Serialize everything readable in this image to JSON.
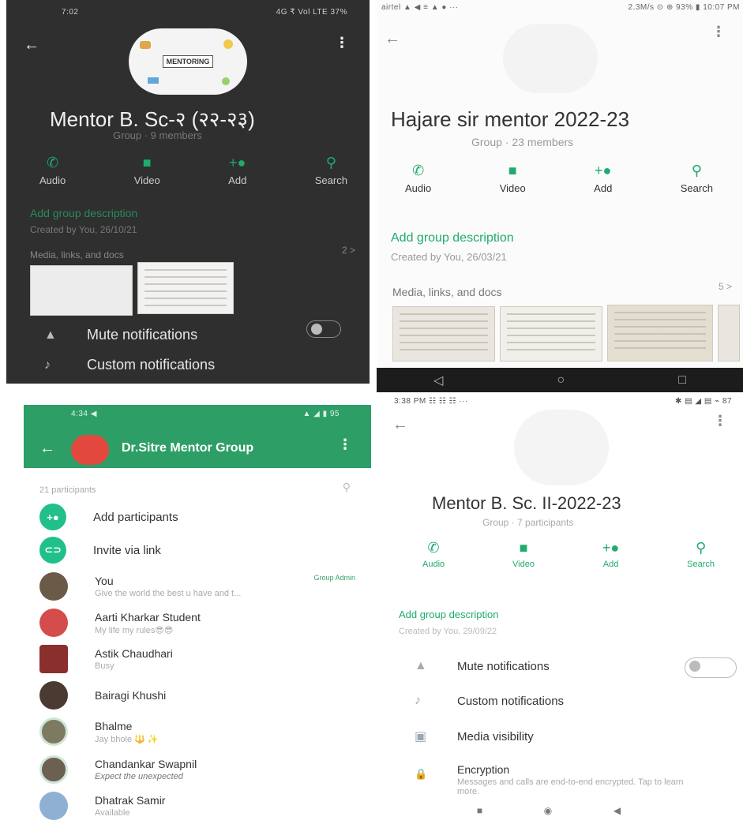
{
  "panel_top_left": {
    "status_time": "7:02",
    "status_right": "4G ₹ Vol LTE 37%",
    "back_icon": "arrow-left-icon",
    "menu_icon": "kebab-menu-icon",
    "avatar_text": "MENTORING",
    "title": "Mentor  B. Sc-२ (२२-२३)",
    "subtitle": "Group · 9 members",
    "actions": [
      {
        "icon": "phone-icon",
        "glyph": "✆",
        "label": "Audio"
      },
      {
        "icon": "video-icon",
        "glyph": "■",
        "label": "Video"
      },
      {
        "icon": "add-user-icon",
        "glyph": "+●",
        "label": "Add"
      },
      {
        "icon": "search-icon",
        "glyph": "⚲",
        "label": "Search"
      }
    ],
    "description_link": "Add group description",
    "created": "Created by You, 26/10/21",
    "media_label": "Media, links, and docs",
    "media_count": "2 >",
    "settings": [
      {
        "icon": "bell-icon",
        "label": "Mute notifications"
      },
      {
        "icon": "music-note-icon",
        "label": "Custom notifications"
      }
    ]
  },
  "panel_top_right": {
    "status_left": "airtel ▲ ◀ ≡ ▲ ● ···",
    "status_right": "2.3M/s ⊙ ⊕ 93% ▮ 10:07 PM",
    "back_icon": "arrow-left-icon",
    "menu_icon": "kebab-menu-icon",
    "title": "Hajare sir mentor 2022-23",
    "subtitle": "Group · 23 members",
    "actions": [
      {
        "icon": "phone-icon",
        "glyph": "✆",
        "label": "Audio"
      },
      {
        "icon": "video-icon",
        "glyph": "■",
        "label": "Video"
      },
      {
        "icon": "add-user-icon",
        "glyph": "+●",
        "label": "Add"
      },
      {
        "icon": "search-icon",
        "glyph": "⚲",
        "label": "Search"
      }
    ],
    "description_link": "Add group description",
    "created": "Created by You, 26/03/21",
    "media_label": "Media, links, and docs",
    "media_count": "5 >",
    "nav": [
      "◁",
      "○",
      "□"
    ]
  },
  "panel_bottom_left": {
    "status_left": "4:34 ◀",
    "status_right": "▲ ◢ ▮ 95",
    "header_title": "Dr.Sitre Mentor Group",
    "participants_count": "21 participants",
    "add_participants": "Add participants",
    "invite_link": "Invite via link",
    "participants": [
      {
        "name": "You",
        "status": "Give the world the best u have and t...",
        "badge": "Group Admin",
        "color": "#6b5a48"
      },
      {
        "name": "Aarti Kharkar Student",
        "status": "My life my rules😎😎",
        "badge": "",
        "color": "#d44c4c"
      },
      {
        "name": "Astik Chaudhari",
        "status": "Busy",
        "badge": "",
        "color": "#8b2e2e"
      },
      {
        "name": "Bairagi Khushi",
        "status": "",
        "badge": "",
        "color": "#4a3a32"
      },
      {
        "name": "Bhalme",
        "status": "Jay bhole 🔱 ✨",
        "badge": "",
        "color": "#7e7a62"
      },
      {
        "name": "Chandankar Swapnil",
        "status": "Expect the unexpected",
        "badge": "",
        "color": "#6d5f52"
      },
      {
        "name": "Dhatrak Samir",
        "status": "Available",
        "badge": "",
        "color": "#8fb0d2"
      }
    ]
  },
  "panel_bottom_right": {
    "status_left": "3:38 PM ☷ ☷ ☷ ···",
    "status_right": "✱ ▤ ◢ ▤ ⌁ 87",
    "back_icon": "arrow-left-icon",
    "menu_icon": "kebab-menu-icon",
    "title": "Mentor B. Sc. II-2022-23",
    "subtitle": "Group · 7 participants",
    "actions": [
      {
        "icon": "phone-icon",
        "glyph": "✆",
        "label": "Audio"
      },
      {
        "icon": "video-icon",
        "glyph": "■",
        "label": "Video"
      },
      {
        "icon": "add-user-icon",
        "glyph": "+●",
        "label": "Add"
      },
      {
        "icon": "search-icon",
        "glyph": "⚲",
        "label": "Search"
      }
    ],
    "description_link": "Add group description",
    "created": "Created by You, 29/09/22",
    "settings": [
      {
        "icon": "bell-icon",
        "glyph": "▲",
        "label": "Mute notifications",
        "sub": ""
      },
      {
        "icon": "music-note-icon",
        "glyph": "♪",
        "label": "Custom notifications",
        "sub": ""
      },
      {
        "icon": "image-icon",
        "glyph": "▣",
        "label": "Media visibility",
        "sub": ""
      },
      {
        "icon": "lock-icon",
        "glyph": "🔒",
        "label": "Encryption",
        "sub": "Messages and calls are end-to-end encrypted. Tap to learn more."
      }
    ],
    "nav": [
      "■",
      "◉",
      "◀"
    ]
  }
}
